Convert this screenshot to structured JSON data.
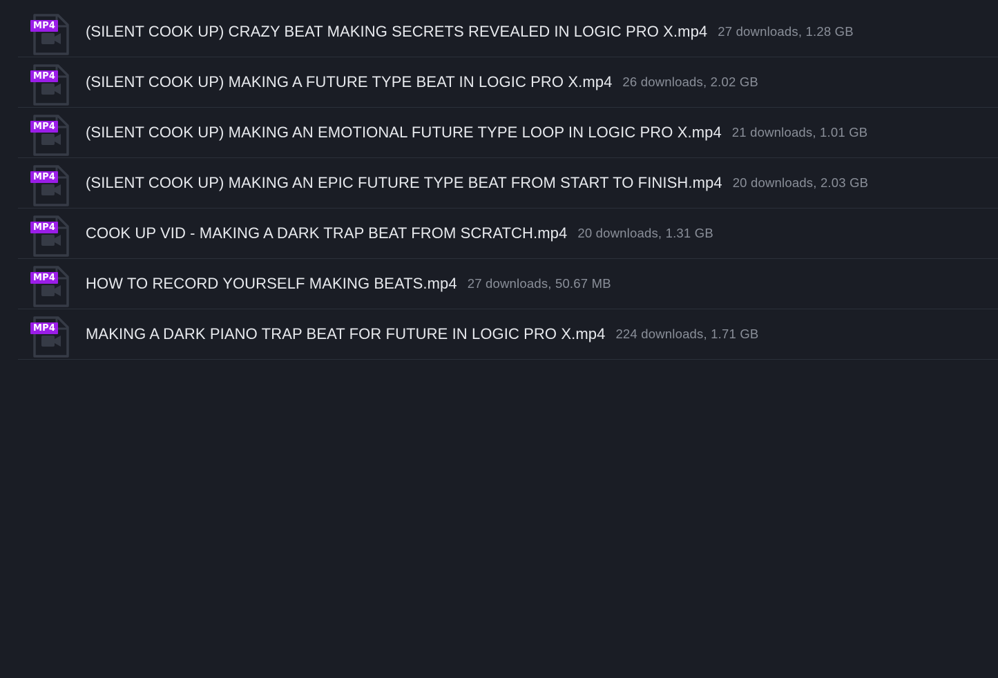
{
  "colors": {
    "background": "#1a1d25",
    "badge": "#9b1de8",
    "file_name": "#e8eaee",
    "file_meta": "#8a8f99",
    "divider": "#2b303a"
  },
  "files": [
    {
      "badge": "MP4",
      "icon": "video-file-icon",
      "name": "(SILENT COOK UP) CRAZY BEAT MAKING SECRETS REVEALED IN LOGIC PRO X.mp4",
      "meta": "27 downloads, 1.28 GB"
    },
    {
      "badge": "MP4",
      "icon": "video-file-icon",
      "name": "(SILENT COOK UP) MAKING A FUTURE TYPE BEAT IN LOGIC PRO X.mp4",
      "meta": "26 downloads, 2.02 GB"
    },
    {
      "badge": "MP4",
      "icon": "video-file-icon",
      "name": "(SILENT COOK UP) MAKING AN EMOTIONAL FUTURE TYPE LOOP IN LOGIC PRO X.mp4",
      "meta": "21 downloads, 1.01 GB"
    },
    {
      "badge": "MP4",
      "icon": "video-file-icon",
      "name": "(SILENT COOK UP) MAKING AN EPIC FUTURE TYPE BEAT FROM START TO FINISH.mp4",
      "meta": "20 downloads, 2.03 GB"
    },
    {
      "badge": "MP4",
      "icon": "video-file-icon",
      "name": "COOK UP VID - MAKING A DARK TRAP BEAT FROM SCRATCH.mp4",
      "meta": "20 downloads, 1.31 GB"
    },
    {
      "badge": "MP4",
      "icon": "video-file-icon",
      "name": "HOW TO RECORD YOURSELF MAKING BEATS.mp4",
      "meta": "27 downloads, 50.67 MB"
    },
    {
      "badge": "MP4",
      "icon": "video-file-icon",
      "name": "MAKING A DARK PIANO TRAP BEAT FOR FUTURE IN LOGIC PRO X.mp4",
      "meta": "224 downloads, 1.71 GB"
    }
  ]
}
